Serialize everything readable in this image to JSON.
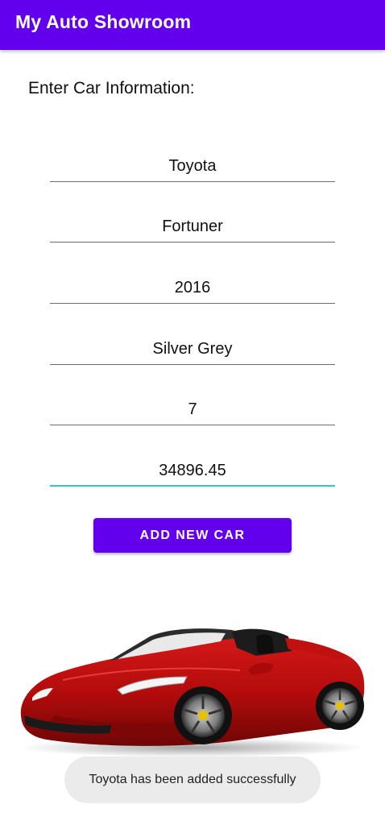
{
  "app_bar": {
    "title": "My Auto Showroom",
    "color": "#6200EE"
  },
  "form": {
    "heading": "Enter Car Information:",
    "fields": [
      {
        "value": "Toyota"
      },
      {
        "value": "Fortuner"
      },
      {
        "value": "2016"
      },
      {
        "value": "Silver Grey"
      },
      {
        "value": "7"
      },
      {
        "value": "34896.45",
        "focused": true
      }
    ],
    "submit_label": "ADD NEW CAR",
    "focus_color": "#2ec8c0"
  },
  "image": {
    "icon": "red-convertible-sports-car"
  },
  "toast": {
    "message": "Toyota has been added successfully"
  }
}
